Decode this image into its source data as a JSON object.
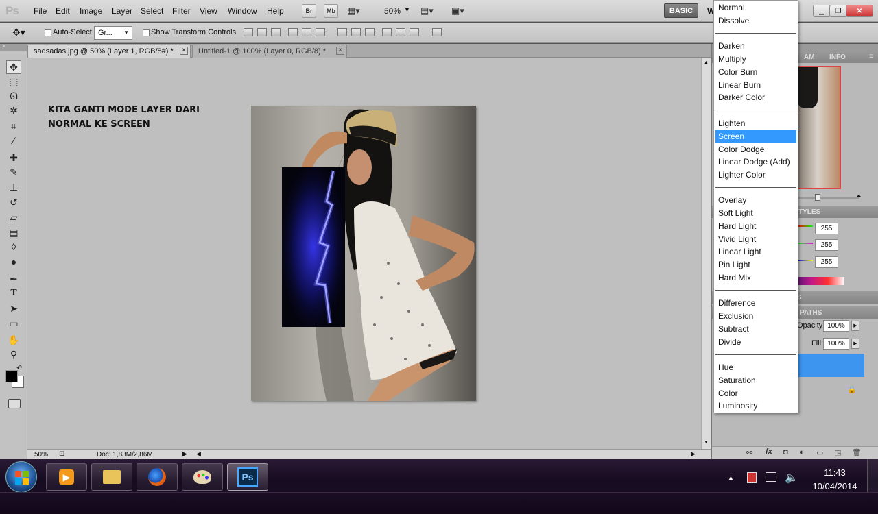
{
  "app": {
    "logo": "Ps"
  },
  "menu": [
    "File",
    "Edit",
    "Image",
    "Layer",
    "Select",
    "Filter",
    "View",
    "Window",
    "Help"
  ],
  "appbar": {
    "bridge": "Br",
    "minibridge": "Mb",
    "zoom": "50%",
    "workspace": "BASIC",
    "workspace_next": "W"
  },
  "options": {
    "auto_select_label": "Auto-Select:",
    "auto_select_value": "Gr...",
    "transform_label": "Show Transform Controls"
  },
  "tabs": [
    {
      "label": "sadsadas.jpg @ 50% (Layer 1, RGB/8#) *",
      "close": "×"
    },
    {
      "label": "Untitled-1 @ 100% (Layer 0, RGB/8) *",
      "close": "×"
    }
  ],
  "canvas_note": {
    "line1": "KITA GANTI MODE LAYER DARI",
    "line2": "NORMAL KE SCREEN"
  },
  "status": {
    "zoom": "50%",
    "doc": "Doc: 1,83M/2,86M"
  },
  "panels": {
    "histogram_tabs": [
      "AM",
      "INFO"
    ],
    "styles_tab": "TYLES",
    "color_values": [
      "255",
      "255",
      "255"
    ],
    "masks_tab": "S",
    "paths_tab": "PATHS",
    "opacity_label": "Opacity:",
    "opacity_value": "100%",
    "fill_label": "Fill:",
    "fill_value": "100%"
  },
  "blend_modes": {
    "groups": [
      [
        "Normal",
        "Dissolve"
      ],
      [
        "Darken",
        "Multiply",
        "Color Burn",
        "Linear Burn",
        "Darker Color"
      ],
      [
        "Lighten",
        "Screen",
        "Color Dodge",
        "Linear Dodge (Add)",
        "Lighter Color"
      ],
      [
        "Overlay",
        "Soft Light",
        "Hard Light",
        "Vivid Light",
        "Linear Light",
        "Pin Light",
        "Hard Mix"
      ],
      [
        "Difference",
        "Exclusion",
        "Subtract",
        "Divide"
      ],
      [
        "Hue",
        "Saturation",
        "Color",
        "Luminosity"
      ]
    ],
    "selected": "Screen"
  },
  "taskbar": {
    "time": "11:43",
    "date": "10/04/2014",
    "ps_label": "Ps"
  },
  "colors": {
    "selection": "#3399ff",
    "taskbar": "#1a0d24",
    "canvas_bg": "#bfbfbf"
  }
}
